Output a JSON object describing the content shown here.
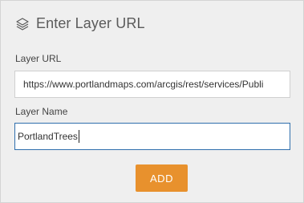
{
  "header": {
    "icon": "layers-icon",
    "title": "Enter Layer URL"
  },
  "form": {
    "url_label": "Layer URL",
    "url_value": "https://www.portlandmaps.com/arcgis/rest/services/Publi",
    "name_label": "Layer Name",
    "name_value": "PortlandTrees"
  },
  "actions": {
    "add_label": "ADD"
  },
  "colors": {
    "panel_bg": "#efefef",
    "button": "#e8912d",
    "focus_border": "#2f6fad"
  }
}
